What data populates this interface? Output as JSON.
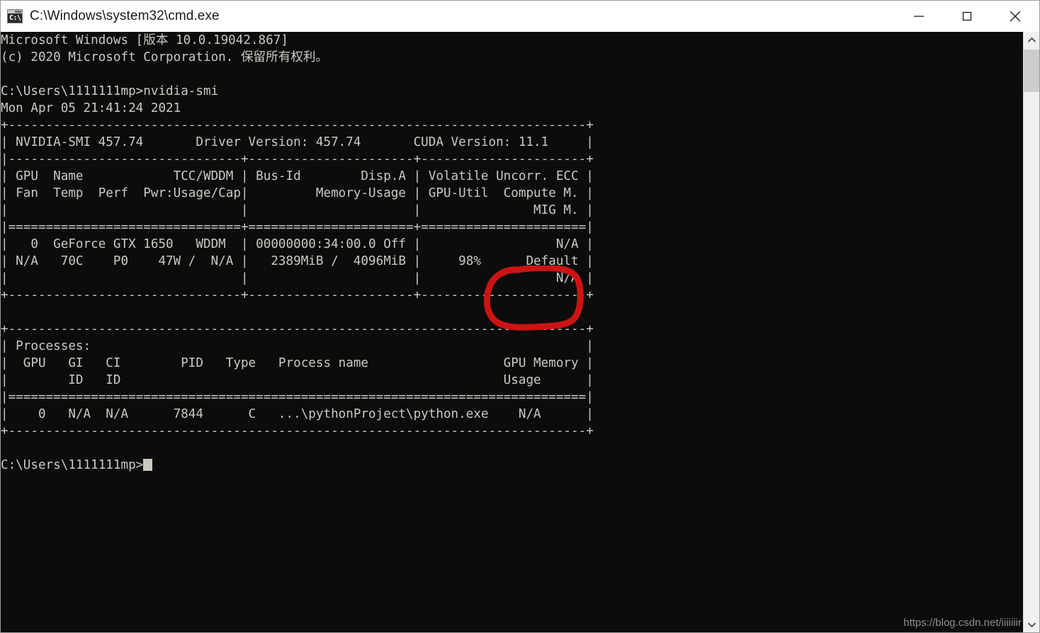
{
  "window": {
    "title": "C:\\Windows\\system32\\cmd.exe",
    "icon_glyph": "C:\\",
    "icon_name": "cmd-console-icon",
    "controls": {
      "minimize": "Minimize",
      "maximize": "Maximize",
      "close": "Close"
    }
  },
  "terminal": {
    "background_color": "#0c0c0c",
    "text_color": "#ccc9c1",
    "lines": [
      "Microsoft Windows [版本 10.0.19042.867]",
      "(c) 2020 Microsoft Corporation. 保留所有权利。",
      "",
      "C:\\Users\\1111111mp>nvidia-smi",
      "Mon Apr 05 21:41:24 2021",
      "+-----------------------------------------------------------------------------+",
      "| NVIDIA-SMI 457.74       Driver Version: 457.74       CUDA Version: 11.1     |",
      "|-------------------------------+----------------------+----------------------+",
      "| GPU  Name            TCC/WDDM | Bus-Id        Disp.A | Volatile Uncorr. ECC |",
      "| Fan  Temp  Perf  Pwr:Usage/Cap|         Memory-Usage | GPU-Util  Compute M. |",
      "|                               |                      |               MIG M. |",
      "|===============================+======================+======================|",
      "|   0  GeForce GTX 1650   WDDM  | 00000000:34:00.0 Off |                  N/A |",
      "| N/A   70C    P0    47W /  N/A |   2389MiB /  4096MiB |     98%      Default |",
      "|                               |                      |                  N/A |",
      "+-------------------------------+----------------------+----------------------+",
      "",
      "+-----------------------------------------------------------------------------+",
      "| Processes:                                                                  |",
      "|  GPU   GI   CI        PID   Type   Process name                  GPU Memory |",
      "|        ID   ID                                                   Usage      |",
      "|=============================================================================|",
      "|    0   N/A  N/A      7844      C   ...\\pythonProject\\python.exe    N/A      |",
      "+-----------------------------------------------------------------------------+",
      "",
      "C:\\Users\\1111111mp>"
    ],
    "prompt_cursor": "block"
  },
  "nvidia_smi": {
    "timestamp": "Mon Apr 05 21:41:24 2021",
    "smi_version": "457.74",
    "driver_version": "457.74",
    "cuda_version": "11.1",
    "gpu": {
      "index": "0",
      "name": "GeForce GTX 1650",
      "tcc_wddm": "WDDM",
      "bus_id": "00000000:34:00.0",
      "disp_a": "Off",
      "uncorr_ecc": "N/A",
      "fan": "N/A",
      "temp": "70C",
      "perf": "P0",
      "pwr_usage": "47W",
      "pwr_cap": "N/A",
      "memory_used": "2389MiB",
      "memory_total": "4096MiB",
      "gpu_util": "98%",
      "compute_m": "Default",
      "mig_m": "N/A"
    },
    "processes": [
      {
        "gpu": "0",
        "gi_id": "N/A",
        "ci_id": "N/A",
        "pid": "7844",
        "type": "C",
        "process_name": "...\\pythonProject\\python.exe",
        "gpu_memory_usage": "N/A"
      }
    ]
  },
  "annotation": {
    "shape": "hand-drawn-circle",
    "color": "#cc1414",
    "targets": "98%"
  },
  "watermark": {
    "text": "https://blog.csdn.net/iiiiiiir"
  },
  "scrollbar": {
    "up_arrow": "▲",
    "down_arrow": "▼"
  }
}
